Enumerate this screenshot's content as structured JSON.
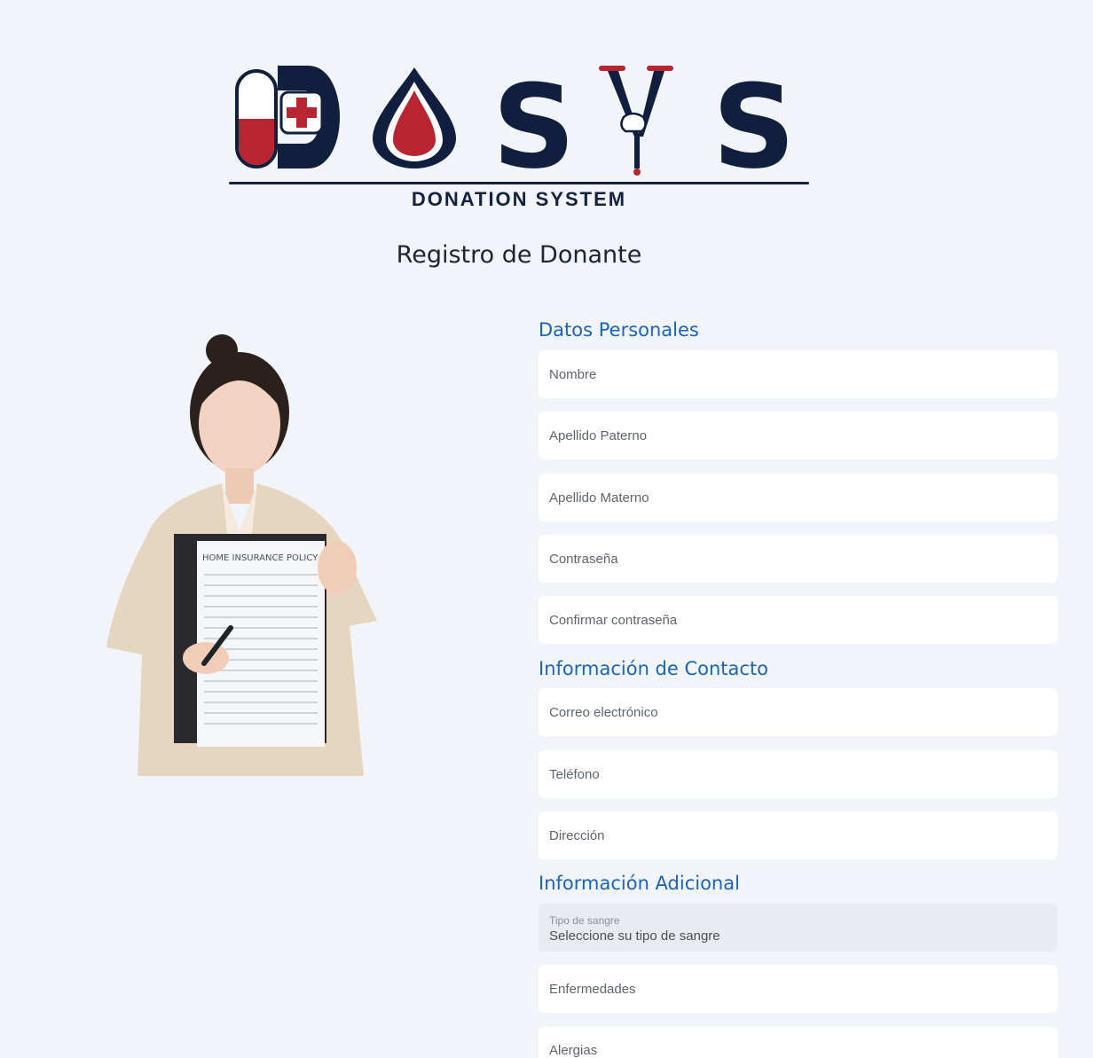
{
  "logo": {
    "wordmark": "DOSYS",
    "subtitle": "DONATION SYSTEM",
    "colors": {
      "navy": "#0f1f3d",
      "red": "#b8242f"
    }
  },
  "page": {
    "title": "Registro de Donante"
  },
  "illustration": {
    "icon": "woman-holding-document",
    "document_title": "HOME INSURANCE POLICY"
  },
  "sections": {
    "personal": {
      "title": "Datos Personales"
    },
    "contact": {
      "title": "Información de Contacto"
    },
    "additional": {
      "title": "Información Adicional"
    }
  },
  "fields": {
    "nombre": {
      "placeholder": "Nombre"
    },
    "apellido_paterno": {
      "placeholder": "Apellido Paterno"
    },
    "apellido_materno": {
      "placeholder": "Apellido Materno"
    },
    "contrasena": {
      "placeholder": "Contraseña"
    },
    "confirmar_contrasena": {
      "placeholder": "Confirmar contraseña"
    },
    "correo": {
      "placeholder": "Correo electrónico"
    },
    "telefono": {
      "placeholder": "Teléfono"
    },
    "direccion": {
      "placeholder": "Dirección"
    },
    "tipo_sangre": {
      "label": "Tipo de sangre",
      "value": "Seleccione su tipo de sangre"
    },
    "enfermedades": {
      "placeholder": "Enfermedades"
    },
    "alergias": {
      "placeholder": "Alergias"
    }
  },
  "colors": {
    "background": "#f1f4f9",
    "section_title": "#1b64b8",
    "field_bg": "#ffffff"
  }
}
